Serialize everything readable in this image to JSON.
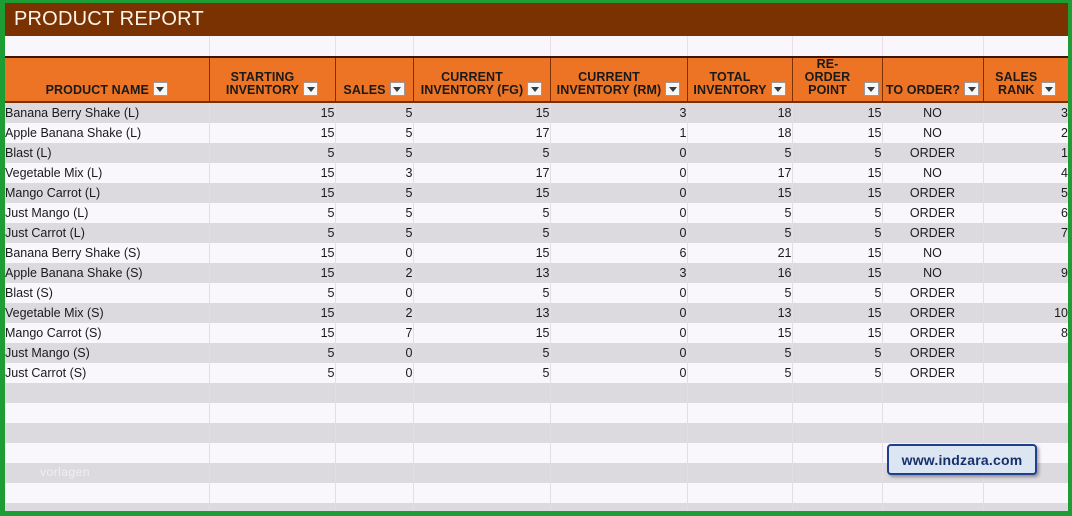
{
  "report": {
    "title": "PRODUCT REPORT",
    "watermark": "vorlagen",
    "badge_url": "www.indzara.com"
  },
  "colors": {
    "title_bar": "#7b3203",
    "header": "#ec7424",
    "band_dark": "#dcdade",
    "band_light": "#faf7fc",
    "frame": "#1f9d35",
    "badge_fill": "#dce6f2",
    "badge_border": "#1f3f8f",
    "badge_text": "#16306e"
  },
  "table": {
    "columns": [
      {
        "label": "PRODUCT NAME",
        "key": "product_name",
        "align": "name",
        "filter": "filter-dropdown-icon"
      },
      {
        "label": "STARTING\nINVENTORY",
        "key": "starting_inventory",
        "align": "num",
        "filter": "filter-dropdown-icon"
      },
      {
        "label": "SALES",
        "key": "sales",
        "align": "num",
        "filter": "filter-dropdown-icon"
      },
      {
        "label": "CURRENT\nINVENTORY (FG)",
        "key": "current_inventory_fg",
        "align": "num",
        "filter": "filter-dropdown-icon"
      },
      {
        "label": "CURRENT\nINVENTORY (RM)",
        "key": "current_inventory_rm",
        "align": "num",
        "filter": "filter-dropdown-icon"
      },
      {
        "label": "TOTAL\nINVENTORY",
        "key": "total_inventory",
        "align": "num",
        "filter": "filter-dropdown-icon"
      },
      {
        "label": "RE-ORDER\nPOINT",
        "key": "reorder_point",
        "align": "num",
        "filter": "filter-dropdown-icon"
      },
      {
        "label": "TO ORDER?",
        "key": "to_order",
        "align": "text",
        "filter": "filter-dropdown-icon"
      },
      {
        "label": "SALES\nRANK",
        "key": "sales_rank",
        "align": "num",
        "filter": "filter-dropdown-icon"
      }
    ],
    "rows": [
      {
        "product_name": "Banana Berry Shake (L)",
        "starting_inventory": "15",
        "sales": "5",
        "current_inventory_fg": "15",
        "current_inventory_rm": "3",
        "total_inventory": "18",
        "reorder_point": "15",
        "to_order": "NO",
        "sales_rank": "3"
      },
      {
        "product_name": "Apple Banana Shake (L)",
        "starting_inventory": "15",
        "sales": "5",
        "current_inventory_fg": "17",
        "current_inventory_rm": "1",
        "total_inventory": "18",
        "reorder_point": "15",
        "to_order": "NO",
        "sales_rank": "2"
      },
      {
        "product_name": "Blast (L)",
        "starting_inventory": "5",
        "sales": "5",
        "current_inventory_fg": "5",
        "current_inventory_rm": "0",
        "total_inventory": "5",
        "reorder_point": "5",
        "to_order": "ORDER",
        "sales_rank": "1"
      },
      {
        "product_name": "Vegetable Mix (L)",
        "starting_inventory": "15",
        "sales": "3",
        "current_inventory_fg": "17",
        "current_inventory_rm": "0",
        "total_inventory": "17",
        "reorder_point": "15",
        "to_order": "NO",
        "sales_rank": "4"
      },
      {
        "product_name": "Mango Carrot (L)",
        "starting_inventory": "15",
        "sales": "5",
        "current_inventory_fg": "15",
        "current_inventory_rm": "0",
        "total_inventory": "15",
        "reorder_point": "15",
        "to_order": "ORDER",
        "sales_rank": "5"
      },
      {
        "product_name": "Just Mango (L)",
        "starting_inventory": "5",
        "sales": "5",
        "current_inventory_fg": "5",
        "current_inventory_rm": "0",
        "total_inventory": "5",
        "reorder_point": "5",
        "to_order": "ORDER",
        "sales_rank": "6"
      },
      {
        "product_name": "Just Carrot (L)",
        "starting_inventory": "5",
        "sales": "5",
        "current_inventory_fg": "5",
        "current_inventory_rm": "0",
        "total_inventory": "5",
        "reorder_point": "5",
        "to_order": "ORDER",
        "sales_rank": "7"
      },
      {
        "product_name": "Banana Berry Shake (S)",
        "starting_inventory": "15",
        "sales": "0",
        "current_inventory_fg": "15",
        "current_inventory_rm": "6",
        "total_inventory": "21",
        "reorder_point": "15",
        "to_order": "NO",
        "sales_rank": ""
      },
      {
        "product_name": "Apple Banana Shake (S)",
        "starting_inventory": "15",
        "sales": "2",
        "current_inventory_fg": "13",
        "current_inventory_rm": "3",
        "total_inventory": "16",
        "reorder_point": "15",
        "to_order": "NO",
        "sales_rank": "9"
      },
      {
        "product_name": "Blast (S)",
        "starting_inventory": "5",
        "sales": "0",
        "current_inventory_fg": "5",
        "current_inventory_rm": "0",
        "total_inventory": "5",
        "reorder_point": "5",
        "to_order": "ORDER",
        "sales_rank": ""
      },
      {
        "product_name": "Vegetable Mix (S)",
        "starting_inventory": "15",
        "sales": "2",
        "current_inventory_fg": "13",
        "current_inventory_rm": "0",
        "total_inventory": "13",
        "reorder_point": "15",
        "to_order": "ORDER",
        "sales_rank": "10"
      },
      {
        "product_name": "Mango Carrot (S)",
        "starting_inventory": "15",
        "sales": "7",
        "current_inventory_fg": "15",
        "current_inventory_rm": "0",
        "total_inventory": "15",
        "reorder_point": "15",
        "to_order": "ORDER",
        "sales_rank": "8"
      },
      {
        "product_name": "Just Mango (S)",
        "starting_inventory": "5",
        "sales": "0",
        "current_inventory_fg": "5",
        "current_inventory_rm": "0",
        "total_inventory": "5",
        "reorder_point": "5",
        "to_order": "ORDER",
        "sales_rank": ""
      },
      {
        "product_name": "Just Carrot (S)",
        "starting_inventory": "5",
        "sales": "0",
        "current_inventory_fg": "5",
        "current_inventory_rm": "0",
        "total_inventory": "5",
        "reorder_point": "5",
        "to_order": "ORDER",
        "sales_rank": ""
      }
    ],
    "empty_row_count": 7
  }
}
